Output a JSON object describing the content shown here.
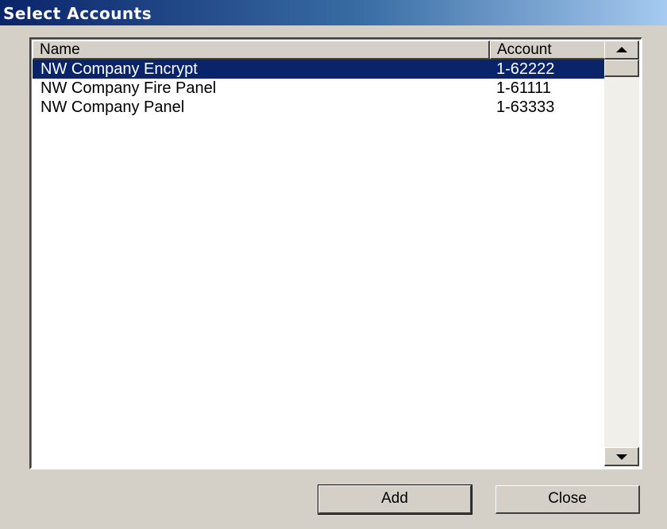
{
  "window": {
    "title": "Select Accounts"
  },
  "list": {
    "columns": [
      "Name",
      "Account"
    ],
    "rows": [
      {
        "name": "NW Company Encrypt",
        "account": "1-62222",
        "selected": true
      },
      {
        "name": "NW Company Fire Panel",
        "account": "1-61111",
        "selected": false
      },
      {
        "name": "NW Company Panel",
        "account": "1-63333",
        "selected": false
      }
    ]
  },
  "buttons": {
    "add_label": "Add",
    "close_label": "Close"
  },
  "colors": {
    "titlebar_start": "#0a246a",
    "titlebar_end": "#a6caf0",
    "selection": "#0a246a",
    "dialog_face": "#d4d0c8"
  },
  "icons": {
    "scroll_up": "triangle-up-icon",
    "scroll_down": "triangle-down-icon"
  }
}
